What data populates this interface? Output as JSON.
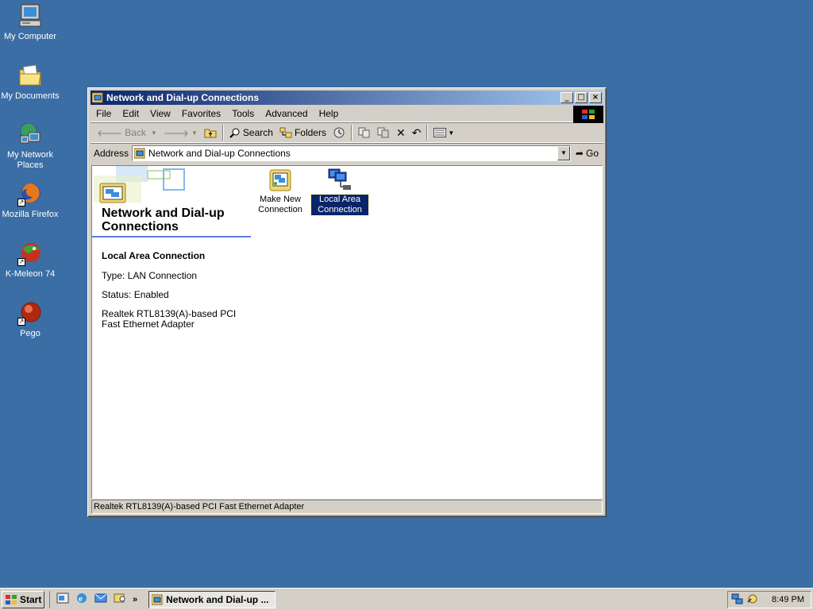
{
  "desktop": {
    "icons": [
      {
        "label": "My Computer",
        "icon": "computer-icon"
      },
      {
        "label": "My Documents",
        "icon": "folder-icon"
      },
      {
        "label": "My Network Places",
        "icon": "network-places-icon"
      },
      {
        "label": "Mozilla Firefox",
        "icon": "firefox-icon"
      },
      {
        "label": "K-Meleon 74",
        "icon": "kmeleon-icon"
      },
      {
        "label": "Pego",
        "icon": "pego-icon"
      }
    ]
  },
  "window": {
    "title": "Network and Dial-up Connections",
    "menu": [
      "File",
      "Edit",
      "View",
      "Favorites",
      "Tools",
      "Advanced",
      "Help"
    ],
    "toolbar": {
      "back": "Back",
      "search": "Search",
      "folders": "Folders"
    },
    "address": {
      "label": "Address",
      "value": "Network and Dial-up Connections",
      "go": "Go"
    },
    "page_title": "Network and Dial-up Connections",
    "details": {
      "name": "Local Area Connection",
      "type": "Type: LAN Connection",
      "status": "Status: Enabled",
      "adapter": "Realtek RTL8139(A)-based PCI Fast Ethernet Adapter"
    },
    "items": [
      {
        "label": "Make New Connection",
        "icon": "make-new-connection-icon"
      },
      {
        "label": "Local Area Connection",
        "icon": "lan-connection-icon",
        "selected": true
      }
    ],
    "status_bar": "Realtek RTL8139(A)-based PCI Fast Ethernet Adapter"
  },
  "taskbar": {
    "start": "Start",
    "task": "Network and Dial-up ...",
    "clock": "8:49 PM"
  },
  "colors": {
    "desktop": "#3a6ea5",
    "title_active_start": "#0a246a",
    "title_active_end": "#a6caf0",
    "face": "#d4d0c8"
  }
}
